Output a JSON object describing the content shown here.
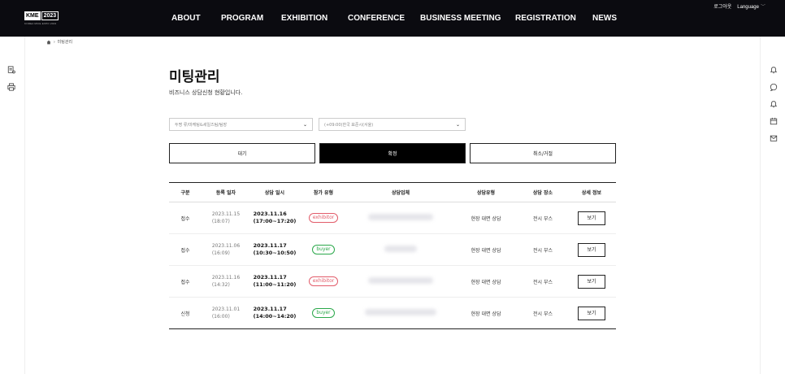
{
  "header": {
    "logo": {
      "brand": "KME",
      "year": "2023",
      "sub": "KOREA MICE EXPO 2023"
    },
    "nav": [
      "ABOUT",
      "PROGRAM",
      "EXHIBITION",
      "CONFERENCE",
      "BUSINESS MEETING",
      "REGISTRATION",
      "NEWS"
    ],
    "logout": "로그아웃",
    "language": "Language"
  },
  "breadcrumb": {
    "current": "미팅관리"
  },
  "page": {
    "title": "미팅관리",
    "description": "비즈니스 상담신청 현황입니다."
  },
  "filters": {
    "sort_value": "두명 류/마케팅&세일즈팀/팀장",
    "timezone_value": "(+09:00)한국 표준시(서울)"
  },
  "status_tabs": [
    "대기",
    "확정",
    "취소/거절"
  ],
  "table": {
    "headers": [
      "구분",
      "등록 일자",
      "상담 일시",
      "참가 유형",
      "상담업체",
      "상담유형",
      "상담 장소",
      "상세 정보"
    ],
    "rows": [
      {
        "kind": "접수",
        "reg_date": "2023.11.15",
        "reg_time": "(18:07)",
        "meet_date": "2023.11.16",
        "meet_time": "(17:00~17:20)",
        "type": "exhibitor",
        "consult_type": "현장 대면 상담",
        "place": "전시 부스",
        "action": "보기"
      },
      {
        "kind": "접수",
        "reg_date": "2023.11.06",
        "reg_time": "(16:09)",
        "meet_date": "2023.11.17",
        "meet_time": "(10:30~10:50)",
        "type": "buyer",
        "consult_type": "현장 대면 상담",
        "place": "전시 부스",
        "action": "보기"
      },
      {
        "kind": "접수",
        "reg_date": "2023.11.16",
        "reg_time": "(14:32)",
        "meet_date": "2023.11.17",
        "meet_time": "(11:00~11:20)",
        "type": "exhibitor",
        "consult_type": "현장 대면 상담",
        "place": "전시 부스",
        "action": "보기"
      },
      {
        "kind": "신청",
        "reg_date": "2023.11.01",
        "reg_time": "(16:00)",
        "meet_date": "2023.11.17",
        "meet_time": "(14:00~14:20)",
        "type": "buyer",
        "consult_type": "현장 대면 상담",
        "place": "전시 부스",
        "action": "보기"
      }
    ]
  },
  "colors": {
    "header_bg": "#0b0b10",
    "exhibitor": "#e25c6a",
    "buyer": "#2aa84a",
    "active_tab": "#000000"
  },
  "icons": {
    "left_rail": [
      "document-icon",
      "printer-icon"
    ],
    "right_rail": [
      "bell-icon",
      "chat-icon",
      "bell-outline-icon",
      "calendar-icon",
      "mail-icon"
    ]
  }
}
